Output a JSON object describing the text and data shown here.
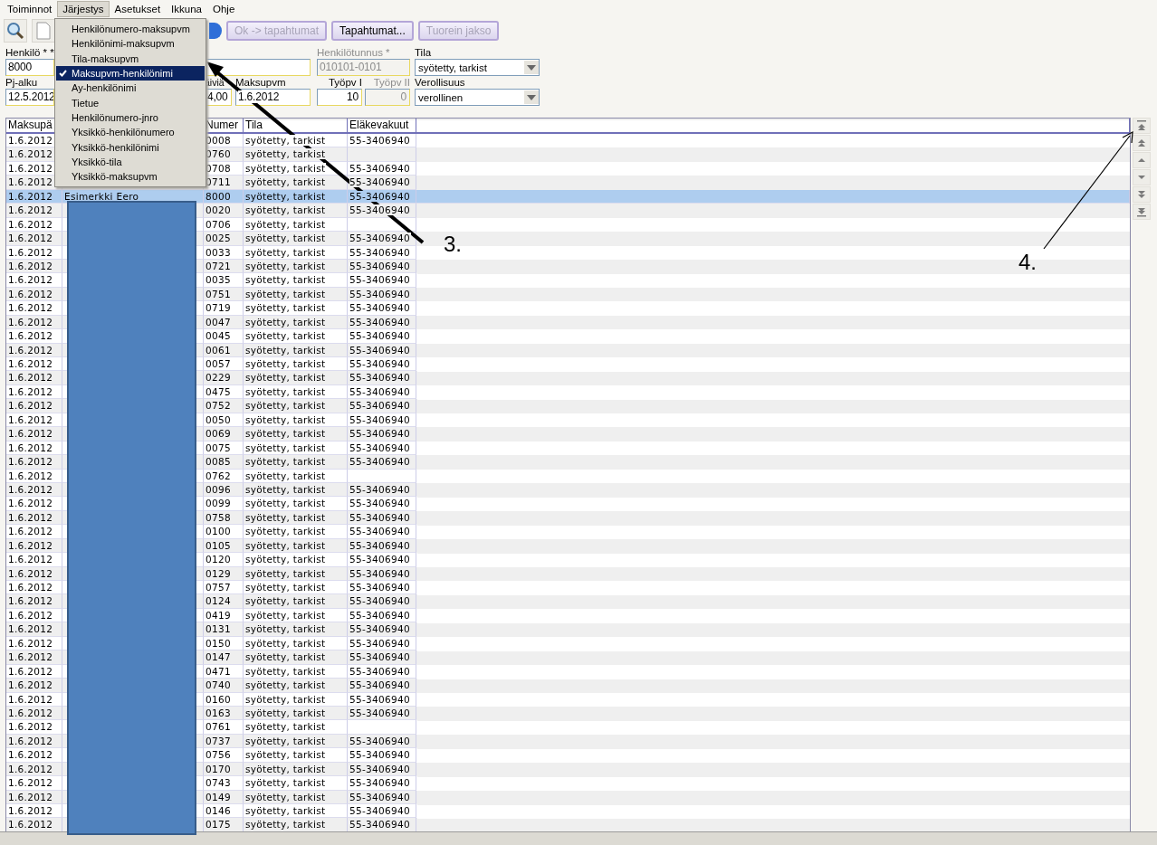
{
  "menu_bar": [
    {
      "label": "Toiminnot",
      "selected": false
    },
    {
      "label": "Järjestys",
      "selected": true
    },
    {
      "label": "Asetukset",
      "selected": false
    },
    {
      "label": "Ikkuna",
      "selected": false
    },
    {
      "label": "Ohje",
      "selected": false
    }
  ],
  "sort_menu": {
    "items": [
      {
        "label": "Henkilönumero-maksupvm",
        "checked": false
      },
      {
        "label": "Henkilönimi-maksupvm",
        "checked": false
      },
      {
        "label": "Tila-maksupvm",
        "checked": false
      },
      {
        "label": "Maksupvm-henkilönimi",
        "checked": true
      },
      {
        "label": "Ay-henkilönimi",
        "checked": false
      },
      {
        "label": "Tietue",
        "checked": false
      },
      {
        "label": "Henkilönumero-jnro",
        "checked": false
      },
      {
        "label": "Yksikkö-henkilönumero",
        "checked": false
      },
      {
        "label": "Yksikkö-henkilönimi",
        "checked": false
      },
      {
        "label": "Yksikkö-tila",
        "checked": false
      },
      {
        "label": "Yksikkö-maksupvm",
        "checked": false
      }
    ]
  },
  "toolbar": {
    "buttons": [
      {
        "label": "Ok -> tapahtumat",
        "disabled": true
      },
      {
        "label": "Tapahtumat...",
        "disabled": false
      },
      {
        "label": "Tuorein jakso",
        "disabled": true
      }
    ]
  },
  "form": {
    "rows": [
      {
        "fields": [
          {
            "kind": "text",
            "label": "Henkilö * *",
            "value": "8000",
            "disabled": false
          },
          {
            "kind": "text",
            "disabled": false
          },
          {
            "kind": "text",
            "label": "Henkilötunnus *",
            "value": "010101-0101",
            "disabled": true
          },
          {
            "kind": "dropdown",
            "label": "Tila",
            "value": "syötetty, tarkist",
            "disabled": false
          }
        ]
      },
      {
        "fields": [
          {
            "kind": "text",
            "label": "Pj-alku",
            "value": "12.5.2012",
            "disabled": false
          },
          {
            "kind": "text",
            "label": "äiviä",
            "value": "4,00",
            "disabled": false
          },
          {
            "kind": "text",
            "label": "Maksupvm",
            "value": "1.6.2012",
            "disabled": false
          },
          {
            "kind": "number",
            "label": "Työpv I",
            "value": "10",
            "disabled": false
          },
          {
            "kind": "number",
            "label": "Työpv II",
            "value": "0",
            "disabled": true
          },
          {
            "kind": "dropdown",
            "label": "Verollisuus",
            "value": "verollinen",
            "disabled": false
          }
        ]
      }
    ]
  },
  "table": {
    "columns": [
      "Maksupä",
      "Numer",
      "Tila",
      "Eläkevakuut"
    ],
    "rows": [
      {
        "date": "1.6.2012",
        "number": "0008",
        "status": "syötetty, tarkist",
        "pension": "55-3406940",
        "selected": false
      },
      {
        "date": "1.6.2012",
        "number": "0760",
        "status": "syötetty, tarkist",
        "selected": false
      },
      {
        "date": "1.6.2012",
        "number": "0708",
        "status": "syötetty, tarkist",
        "pension": "55-3406940",
        "selected": false
      },
      {
        "date": "1.6.2012",
        "number": "0711",
        "status": "syötetty, tarkist",
        "pension": "55-3406940",
        "selected": false
      },
      {
        "date": "1.6.2012",
        "name": "Esimerkki Eero",
        "number": "8000",
        "status": "syötetty, tarkist",
        "pension": "55-3406940",
        "selected": true
      },
      {
        "date": "1.6.2012",
        "number": "0020",
        "status": "syötetty, tarkist",
        "pension": "55-3406940",
        "selected": false
      },
      {
        "date": "1.6.2012",
        "number": "0706",
        "status": "syötetty, tarkist",
        "selected": false
      },
      {
        "date": "1.6.2012",
        "number": "0025",
        "status": "syötetty, tarkist",
        "pension": "55-3406940",
        "selected": false
      },
      {
        "date": "1.6.2012",
        "number": "0033",
        "status": "syötetty, tarkist",
        "pension": "55-3406940",
        "selected": false
      },
      {
        "date": "1.6.2012",
        "number": "0721",
        "status": "syötetty, tarkist",
        "pension": "55-3406940",
        "selected": false
      },
      {
        "date": "1.6.2012",
        "number": "0035",
        "status": "syötetty, tarkist",
        "pension": "55-3406940",
        "selected": false
      },
      {
        "date": "1.6.2012",
        "number": "0751",
        "status": "syötetty, tarkist",
        "pension": "55-3406940",
        "selected": false
      },
      {
        "date": "1.6.2012",
        "number": "0719",
        "status": "syötetty, tarkist",
        "pension": "55-3406940",
        "selected": false
      },
      {
        "date": "1.6.2012",
        "number": "0047",
        "status": "syötetty, tarkist",
        "pension": "55-3406940",
        "selected": false
      },
      {
        "date": "1.6.2012",
        "number": "0045",
        "status": "syötetty, tarkist",
        "pension": "55-3406940",
        "selected": false
      },
      {
        "date": "1.6.2012",
        "number": "0061",
        "status": "syötetty, tarkist",
        "pension": "55-3406940",
        "selected": false
      },
      {
        "date": "1.6.2012",
        "number": "0057",
        "status": "syötetty, tarkist",
        "pension": "55-3406940",
        "selected": false
      },
      {
        "date": "1.6.2012",
        "number": "0229",
        "status": "syötetty, tarkist",
        "pension": "55-3406940",
        "selected": false
      },
      {
        "date": "1.6.2012",
        "number": "0475",
        "status": "syötetty, tarkist",
        "pension": "55-3406940",
        "selected": false
      },
      {
        "date": "1.6.2012",
        "number": "0752",
        "status": "syötetty, tarkist",
        "pension": "55-3406940",
        "selected": false
      },
      {
        "date": "1.6.2012",
        "number": "0050",
        "status": "syötetty, tarkist",
        "pension": "55-3406940",
        "selected": false
      },
      {
        "date": "1.6.2012",
        "number": "0069",
        "status": "syötetty, tarkist",
        "pension": "55-3406940",
        "selected": false
      },
      {
        "date": "1.6.2012",
        "number": "0075",
        "status": "syötetty, tarkist",
        "pension": "55-3406940",
        "selected": false
      },
      {
        "date": "1.6.2012",
        "number": "0085",
        "status": "syötetty, tarkist",
        "pension": "55-3406940",
        "selected": false
      },
      {
        "date": "1.6.2012",
        "number": "0762",
        "status": "syötetty, tarkist",
        "selected": false
      },
      {
        "date": "1.6.2012",
        "number": "0096",
        "status": "syötetty, tarkist",
        "pension": "55-3406940",
        "selected": false
      },
      {
        "date": "1.6.2012",
        "number": "0099",
        "status": "syötetty, tarkist",
        "pension": "55-3406940",
        "selected": false
      },
      {
        "date": "1.6.2012",
        "number": "0758",
        "status": "syötetty, tarkist",
        "pension": "55-3406940",
        "selected": false
      },
      {
        "date": "1.6.2012",
        "number": "0100",
        "status": "syötetty, tarkist",
        "pension": "55-3406940",
        "selected": false
      },
      {
        "date": "1.6.2012",
        "number": "0105",
        "status": "syötetty, tarkist",
        "pension": "55-3406940",
        "selected": false
      },
      {
        "date": "1.6.2012",
        "number": "0120",
        "status": "syötetty, tarkist",
        "pension": "55-3406940",
        "selected": false
      },
      {
        "date": "1.6.2012",
        "number": "0129",
        "status": "syötetty, tarkist",
        "pension": "55-3406940",
        "selected": false
      },
      {
        "date": "1.6.2012",
        "number": "0757",
        "status": "syötetty, tarkist",
        "pension": "55-3406940",
        "selected": false
      },
      {
        "date": "1.6.2012",
        "number": "0124",
        "status": "syötetty, tarkist",
        "pension": "55-3406940",
        "selected": false
      },
      {
        "date": "1.6.2012",
        "number": "0419",
        "status": "syötetty, tarkist",
        "pension": "55-3406940",
        "selected": false
      },
      {
        "date": "1.6.2012",
        "number": "0131",
        "status": "syötetty, tarkist",
        "pension": "55-3406940",
        "selected": false
      },
      {
        "date": "1.6.2012",
        "number": "0150",
        "status": "syötetty, tarkist",
        "pension": "55-3406940",
        "selected": false
      },
      {
        "date": "1.6.2012",
        "number": "0147",
        "status": "syötetty, tarkist",
        "pension": "55-3406940",
        "selected": false
      },
      {
        "date": "1.6.2012",
        "number": "0471",
        "status": "syötetty, tarkist",
        "pension": "55-3406940",
        "selected": false
      },
      {
        "date": "1.6.2012",
        "number": "0740",
        "status": "syötetty, tarkist",
        "pension": "55-3406940",
        "selected": false
      },
      {
        "date": "1.6.2012",
        "number": "0160",
        "status": "syötetty, tarkist",
        "pension": "55-3406940",
        "selected": false
      },
      {
        "date": "1.6.2012",
        "number": "0163",
        "status": "syötetty, tarkist",
        "pension": "55-3406940",
        "selected": false
      },
      {
        "date": "1.6.2012",
        "number": "0761",
        "status": "syötetty, tarkist",
        "selected": false
      },
      {
        "date": "1.6.2012",
        "number": "0737",
        "status": "syötetty, tarkist",
        "pension": "55-3406940",
        "selected": false
      },
      {
        "date": "1.6.2012",
        "number": "0756",
        "status": "syötetty, tarkist",
        "pension": "55-3406940",
        "selected": false
      },
      {
        "date": "1.6.2012",
        "number": "0170",
        "status": "syötetty, tarkist",
        "pension": "55-3406940",
        "selected": false
      },
      {
        "date": "1.6.2012",
        "number": "0743",
        "status": "syötetty, tarkist",
        "pension": "55-3406940",
        "selected": false
      },
      {
        "date": "1.6.2012",
        "number": "0149",
        "status": "syötetty, tarkist",
        "pension": "55-3406940",
        "selected": false
      },
      {
        "date": "1.6.2012",
        "number": "0146",
        "status": "syötetty, tarkist",
        "pension": "55-3406940",
        "selected": false
      },
      {
        "date": "1.6.2012",
        "number": "0175",
        "status": "syötetty, tarkist",
        "pension": "55-3406940",
        "selected": false
      }
    ]
  },
  "annotations": [
    {
      "label": "3."
    },
    {
      "label": "4."
    }
  ]
}
